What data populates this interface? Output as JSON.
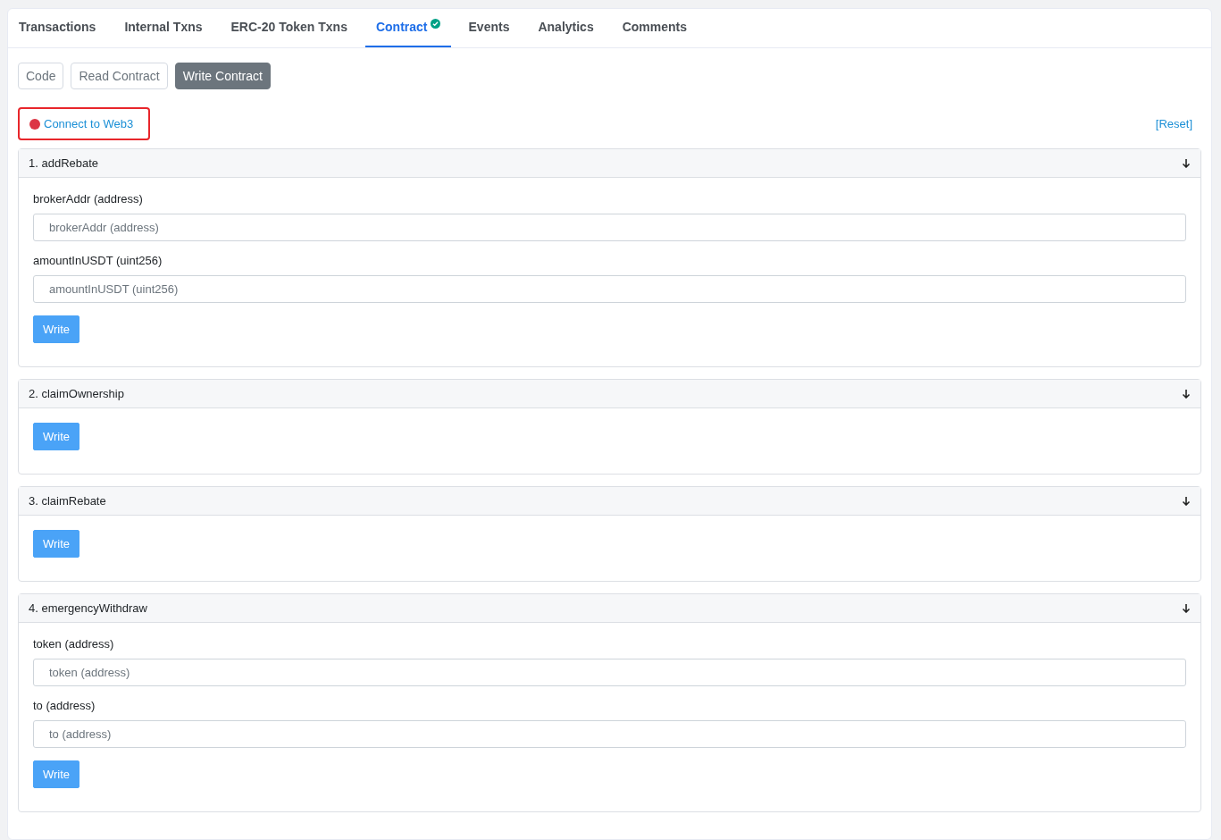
{
  "tabs": [
    {
      "label": "Transactions",
      "selected": false,
      "verified": false
    },
    {
      "label": "Internal Txns",
      "selected": false,
      "verified": false
    },
    {
      "label": "ERC-20 Token Txns",
      "selected": false,
      "verified": false
    },
    {
      "label": "Contract",
      "selected": true,
      "verified": true
    },
    {
      "label": "Events",
      "selected": false,
      "verified": false
    },
    {
      "label": "Analytics",
      "selected": false,
      "verified": false
    },
    {
      "label": "Comments",
      "selected": false,
      "verified": false
    }
  ],
  "subtabs": [
    {
      "label": "Code",
      "selected": false
    },
    {
      "label": "Read Contract",
      "selected": false
    },
    {
      "label": "Write Contract",
      "selected": true
    }
  ],
  "connect": {
    "label": "Connect to Web3",
    "connected": false,
    "highlighted": true
  },
  "reset": "[Reset]",
  "functions": [
    {
      "title": "1. addRebate",
      "inputs": [
        {
          "label": "brokerAddr (address)",
          "placeholder": "brokerAddr (address)"
        },
        {
          "label": "amountInUSDT (uint256)",
          "placeholder": "amountInUSDT (uint256)"
        }
      ],
      "button": "Write"
    },
    {
      "title": "2. claimOwnership",
      "button": "Write"
    },
    {
      "title": "3. claimRebate",
      "button": "Write"
    },
    {
      "title": "4. emergencyWithdraw",
      "inputs": [
        {
          "label": "token (address)",
          "placeholder": "token (address)"
        },
        {
          "label": "to (address)",
          "placeholder": "to (address)"
        }
      ],
      "button": "Write"
    }
  ]
}
